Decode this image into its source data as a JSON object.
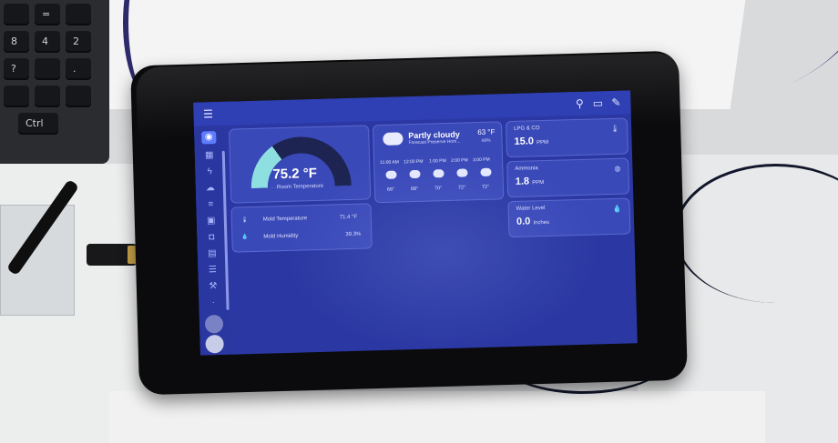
{
  "topbar": {
    "menu_icon": "menu-icon",
    "icons": [
      "search-icon",
      "chat-icon",
      "edit-icon"
    ]
  },
  "sidebar": {
    "icons": [
      "eye-icon",
      "grid-icon",
      "bolt-icon",
      "weather-icon",
      "list-icon",
      "image-icon",
      "camera-icon",
      "calendar-icon",
      "notes-icon",
      "wrench-icon",
      "dots-icon"
    ]
  },
  "thermostat": {
    "value": "75.2 °F",
    "label": "Room Temperature",
    "fill_fraction": 0.31
  },
  "mold": {
    "rows": [
      {
        "icon": "thermometer-icon",
        "label": "Mold Temperature",
        "value": "71.4 °F"
      },
      {
        "icon": "droplet-icon",
        "label": "Mold Humidity",
        "value": "39.3%"
      }
    ]
  },
  "weather": {
    "condition": "Partly cloudy",
    "subtitle": "Forecast Preserve Hom...",
    "temp": "63 °F",
    "humidity": "49%",
    "forecast": [
      {
        "time": "11:00 AM",
        "temp": "66°"
      },
      {
        "time": "12:00 PM",
        "temp": "68°"
      },
      {
        "time": "1:00 PM",
        "temp": "70°"
      },
      {
        "time": "2:00 PM",
        "temp": "72°"
      },
      {
        "time": "3:00 PM",
        "temp": "72°"
      }
    ]
  },
  "sensors": [
    {
      "title": "LPG & CO",
      "value": "15.0",
      "unit": "PPM",
      "icon": "thermometer-icon"
    },
    {
      "title": "Ammonia",
      "value": "1.8",
      "unit": "PPM",
      "icon": "gauge-icon"
    },
    {
      "title": "Water Level",
      "value": "0.0",
      "unit": "Inches",
      "icon": "droplet-icon"
    }
  ],
  "keyboard": {
    "keys": [
      "Ctrl",
      "=",
      "?",
      ".",
      "8",
      "4",
      "2"
    ]
  }
}
